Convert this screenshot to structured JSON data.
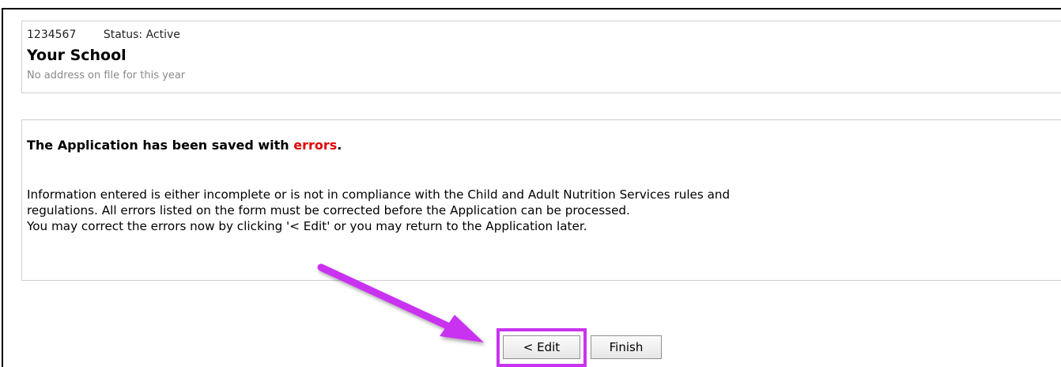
{
  "school": {
    "id": "1234567",
    "status": "Status: Active",
    "name": "Your School",
    "address_note": "No address on file for this year"
  },
  "message": {
    "title_prefix": "The Application has been saved with ",
    "title_error_word": "errors",
    "title_suffix": ".",
    "body_lines": [
      "Information entered is either incomplete or is not in compliance with the Child and Adult Nutrition Services rules and",
      "regulations. All errors listed on the form must be corrected before the Application can be processed.",
      "You may correct the errors now by clicking '< Edit' or you may return to the Application later."
    ]
  },
  "actions": {
    "edit_label": "< Edit",
    "finish_label": "Finish"
  },
  "annotation": {
    "highlight_color": "#c933f0",
    "error_color": "#e00000"
  }
}
